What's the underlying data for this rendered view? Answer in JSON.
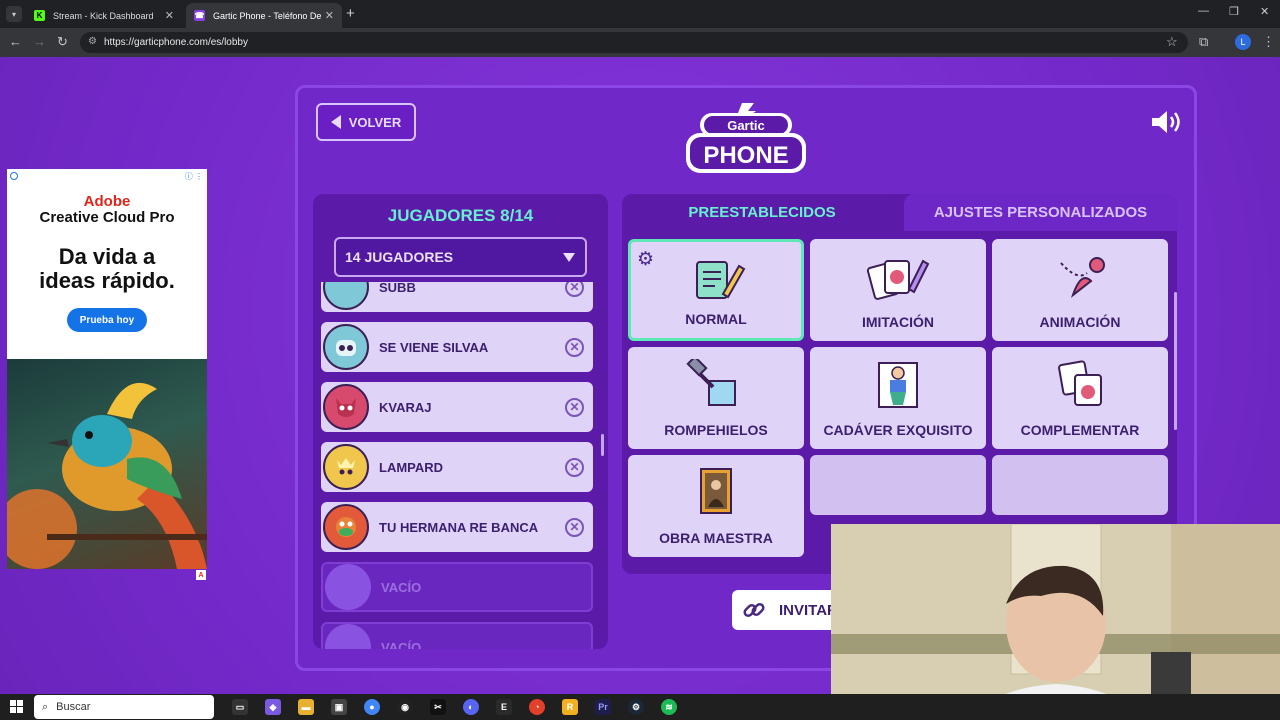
{
  "browser": {
    "tabs": [
      {
        "title": "Stream - Kick Dashboard",
        "active": false,
        "favicon": "kick-icon"
      },
      {
        "title": "Gartic Phone - Teléfono Descon",
        "active": true,
        "favicon": "gartic-icon"
      }
    ],
    "url": "https://garticphone.com/es/lobby",
    "profile_initial": "L"
  },
  "ad": {
    "brand": "Adobe",
    "product": "Creative Cloud Pro",
    "headline_line1": "Da vida a",
    "headline_line2": "ideas rápido.",
    "cta": "Prueba hoy",
    "badge": "A"
  },
  "lobby": {
    "back_label": "VOLVER",
    "players_title": "JUGADORES 8/14",
    "players_dropdown": "14 JUGADORES",
    "players": [
      {
        "name": "SUBB",
        "avatar": "robot-avatar",
        "color": "#7fc8d8"
      },
      {
        "name": "SE VIENE SILVAA",
        "avatar": "robot-avatar",
        "color": "#7fc8d8"
      },
      {
        "name": "KVARAJ",
        "avatar": "demon-avatar",
        "color": "#d74a6e"
      },
      {
        "name": "LAMPARD",
        "avatar": "crown-avatar",
        "color": "#f0c64d"
      },
      {
        "name": "TU HERMANA RE BANCA",
        "avatar": "bird-avatar",
        "color": "#e25a3a"
      },
      {
        "name": "VACÍO",
        "avatar": "empty-avatar",
        "empty": true
      },
      {
        "name": "VACÍO",
        "avatar": "empty-avatar",
        "empty": true
      }
    ],
    "tabs": {
      "preset": "PREESTABLECIDOS",
      "custom": "AJUSTES PERSONALIZADOS"
    },
    "modes": [
      {
        "label": "NORMAL",
        "icon": "notepad-pencil-icon",
        "selected": true
      },
      {
        "label": "IMITACIÓN",
        "icon": "cards-icon"
      },
      {
        "label": "ANIMACIÓN",
        "icon": "animation-pen-icon"
      },
      {
        "label": "ROMPEHIELOS",
        "icon": "hammer-ice-icon"
      },
      {
        "label": "CADÁVER EXQUISITO",
        "icon": "exquisite-corpse-icon"
      },
      {
        "label": "COMPLEMENTAR",
        "icon": "complement-icon"
      },
      {
        "label": "OBRA MAESTRA",
        "icon": "mona-lisa-icon"
      }
    ],
    "invite_label": "INVITAR"
  },
  "taskbar": {
    "search_placeholder": "Buscar",
    "apps": [
      "task-view-icon",
      "copilot-icon",
      "file-explorer-icon",
      "store-icon",
      "chrome-icon",
      "obs-icon",
      "capcut-icon",
      "discord-icon",
      "epic-games-icon",
      "ea-icon",
      "rockstar-icon",
      "premiere-icon",
      "steam-icon",
      "spotify-icon"
    ]
  }
}
